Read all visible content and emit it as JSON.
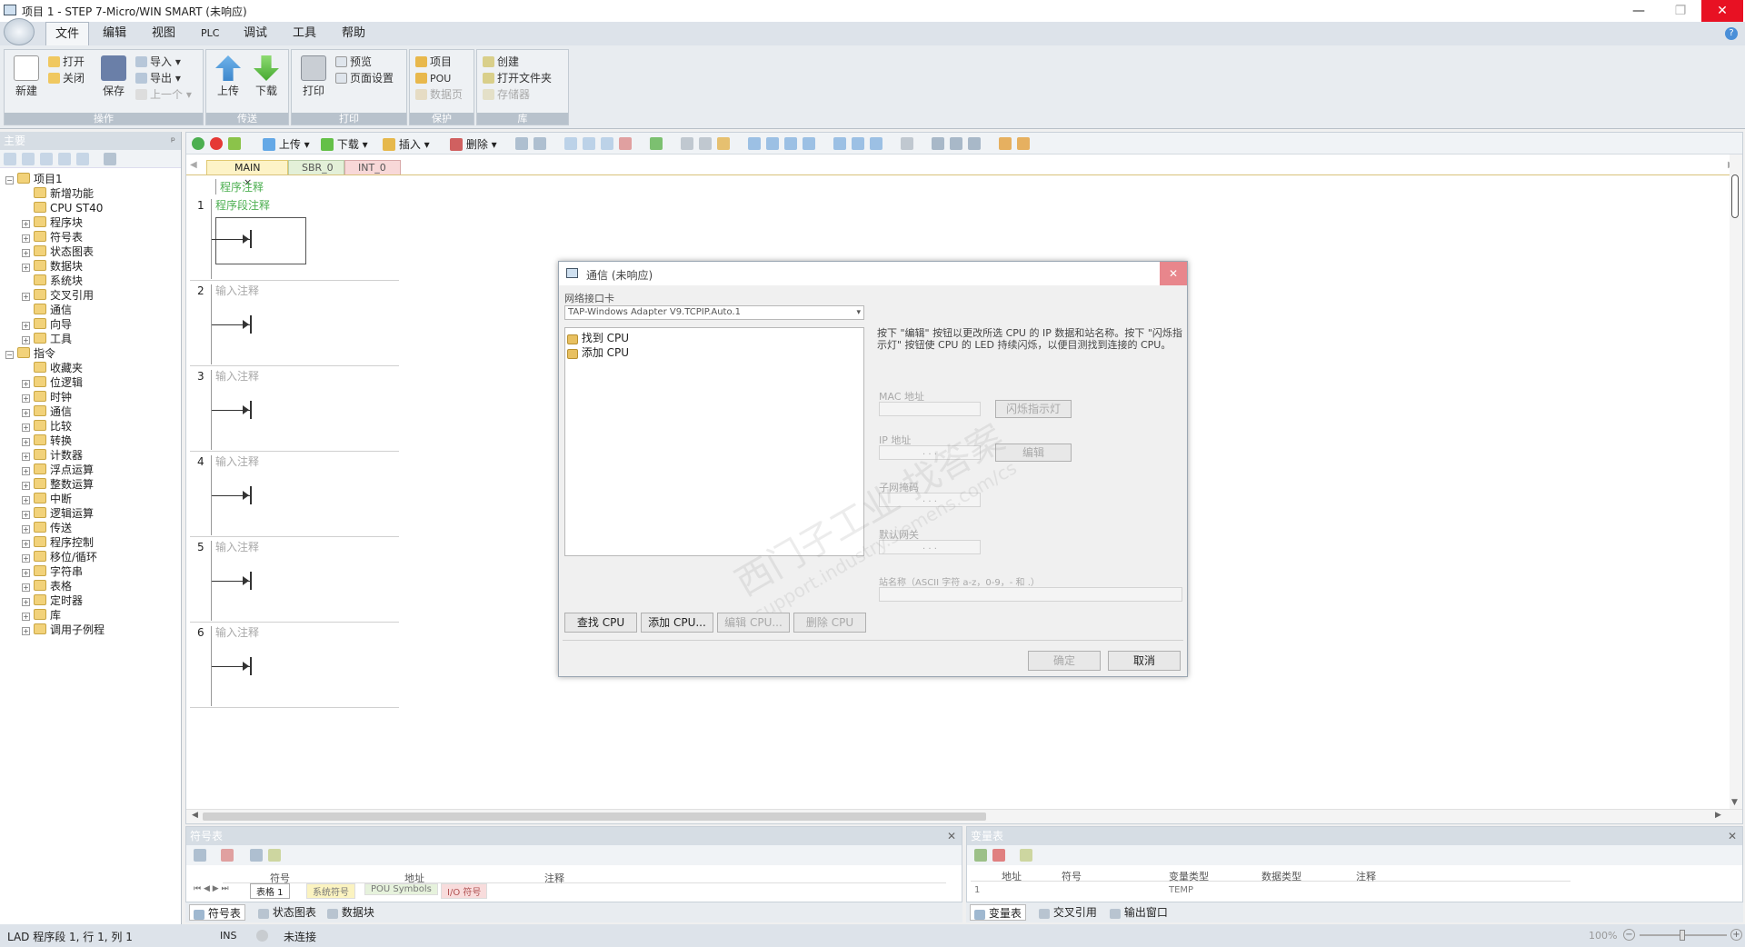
{
  "window": {
    "title": "项目 1 - STEP 7-Micro/WIN SMART (未响应)",
    "minimize_glyph": "—",
    "restore_glyph": "❐",
    "close_glyph": "✕"
  },
  "menu": {
    "items": [
      "文件",
      "编辑",
      "视图",
      "PLC",
      "调试",
      "工具",
      "帮助"
    ],
    "active": "文件",
    "help_glyph": "?"
  },
  "ribbon": {
    "groups": [
      {
        "label": "操作",
        "big": [
          {
            "label": "新建",
            "icon": "new-document-icon"
          },
          {
            "label": "保存",
            "icon": "save-icon"
          }
        ],
        "small": [
          {
            "label": "打开",
            "icon": "open-folder-icon",
            "disabled": false
          },
          {
            "label": "关闭",
            "icon": "close-folder-icon",
            "disabled": false
          },
          {
            "label": "导入",
            "icon": "import-icon",
            "disabled": false
          },
          {
            "label": "导出",
            "icon": "export-icon",
            "disabled": false
          },
          {
            "label": "上一个",
            "icon": "previous-icon",
            "disabled": true
          }
        ]
      },
      {
        "label": "传送",
        "big": [
          {
            "label": "上传",
            "icon": "upload-arrow-icon"
          },
          {
            "label": "下载",
            "icon": "download-arrow-icon"
          }
        ],
        "small": []
      },
      {
        "label": "打印",
        "big": [
          {
            "label": "打印",
            "icon": "printer-icon"
          }
        ],
        "small": [
          {
            "label": "预览",
            "icon": "preview-icon",
            "disabled": false
          },
          {
            "label": "页面设置",
            "icon": "page-setup-icon",
            "disabled": false
          }
        ]
      },
      {
        "label": "保护",
        "big": [],
        "small": [
          {
            "label": "项目",
            "icon": "project-lock-icon",
            "disabled": false
          },
          {
            "label": "POU",
            "icon": "pou-lock-icon",
            "disabled": false
          },
          {
            "label": "数据页",
            "icon": "datapage-lock-icon",
            "disabled": true
          }
        ]
      },
      {
        "label": "库",
        "big": [],
        "small": [
          {
            "label": "创建",
            "icon": "library-create-icon",
            "disabled": false
          },
          {
            "label": "打开文件夹",
            "icon": "library-folder-icon",
            "disabled": false
          },
          {
            "label": "存储器",
            "icon": "memory-icon",
            "disabled": true
          }
        ]
      }
    ]
  },
  "left_panel": {
    "title": "主要",
    "pin_glyph": "ᵖ",
    "tree": [
      {
        "label": "项目1",
        "level": 0,
        "expander": "−",
        "icon": "project-icon"
      },
      {
        "label": "新增功能",
        "level": 1,
        "expander": "",
        "icon": "whats-new-icon"
      },
      {
        "label": "CPU ST40",
        "level": 1,
        "expander": "",
        "icon": "cpu-icon"
      },
      {
        "label": "程序块",
        "level": 1,
        "expander": "+",
        "icon": "program-block-icon"
      },
      {
        "label": "符号表",
        "level": 1,
        "expander": "+",
        "icon": "symbol-table-icon"
      },
      {
        "label": "状态图表",
        "level": 1,
        "expander": "+",
        "icon": "status-chart-icon"
      },
      {
        "label": "数据块",
        "level": 1,
        "expander": "+",
        "icon": "data-block-icon"
      },
      {
        "label": "系统块",
        "level": 1,
        "expander": "",
        "icon": "system-block-icon"
      },
      {
        "label": "交叉引用",
        "level": 1,
        "expander": "+",
        "icon": "cross-reference-icon"
      },
      {
        "label": "通信",
        "level": 1,
        "expander": "",
        "icon": "communication-icon"
      },
      {
        "label": "向导",
        "level": 1,
        "expander": "+",
        "icon": "wizard-icon"
      },
      {
        "label": "工具",
        "level": 1,
        "expander": "+",
        "icon": "tools-icon"
      },
      {
        "label": "指令",
        "level": 0,
        "expander": "−",
        "icon": "instructions-icon"
      },
      {
        "label": "收藏夹",
        "level": 1,
        "expander": "",
        "icon": "favorites-icon"
      },
      {
        "label": "位逻辑",
        "level": 1,
        "expander": "+",
        "icon": "bit-logic-icon"
      },
      {
        "label": "时钟",
        "level": 1,
        "expander": "+",
        "icon": "clock-icon"
      },
      {
        "label": "通信",
        "level": 1,
        "expander": "+",
        "icon": "communication-icon"
      },
      {
        "label": "比较",
        "level": 1,
        "expander": "+",
        "icon": "compare-icon"
      },
      {
        "label": "转换",
        "level": 1,
        "expander": "+",
        "icon": "convert-icon"
      },
      {
        "label": "计数器",
        "level": 1,
        "expander": "+",
        "icon": "counter-icon"
      },
      {
        "label": "浮点运算",
        "level": 1,
        "expander": "+",
        "icon": "floating-point-icon"
      },
      {
        "label": "整数运算",
        "level": 1,
        "expander": "+",
        "icon": "integer-math-icon"
      },
      {
        "label": "中断",
        "level": 1,
        "expander": "+",
        "icon": "interrupt-icon"
      },
      {
        "label": "逻辑运算",
        "level": 1,
        "expander": "+",
        "icon": "logic-ops-icon"
      },
      {
        "label": "传送",
        "level": 1,
        "expander": "+",
        "icon": "move-icon"
      },
      {
        "label": "程序控制",
        "level": 1,
        "expander": "+",
        "icon": "program-control-icon"
      },
      {
        "label": "移位/循环",
        "level": 1,
        "expander": "+",
        "icon": "shift-rotate-icon"
      },
      {
        "label": "字符串",
        "level": 1,
        "expander": "+",
        "icon": "string-icon"
      },
      {
        "label": "表格",
        "level": 1,
        "expander": "+",
        "icon": "table-icon"
      },
      {
        "label": "定时器",
        "level": 1,
        "expander": "+",
        "icon": "timer-icon"
      },
      {
        "label": "库",
        "level": 1,
        "expander": "+",
        "icon": "library-icon"
      },
      {
        "label": "调用子例程",
        "level": 1,
        "expander": "+",
        "icon": "call-subroutine-icon"
      }
    ]
  },
  "editor_toolbar": {
    "upload": "上传",
    "download": "下载",
    "insert": "插入",
    "delete": "删除"
  },
  "editor_tabs": [
    {
      "label": "MAIN",
      "active": true,
      "close": "×"
    },
    {
      "label": "SBR_0",
      "active": false
    },
    {
      "label": "INT_0",
      "active": false
    }
  ],
  "editor": {
    "program_comment": "程序注释",
    "networks": [
      {
        "number": "1",
        "comment": "程序段注释"
      },
      {
        "number": "2",
        "comment": "输入注释"
      },
      {
        "number": "3",
        "comment": "输入注释"
      },
      {
        "number": "4",
        "comment": "输入注释"
      },
      {
        "number": "5",
        "comment": "输入注释"
      },
      {
        "number": "6",
        "comment": "输入注释"
      }
    ],
    "coil_glyph": "→|"
  },
  "dialog": {
    "title": "通信 (未响应)",
    "close_glyph": "✕",
    "nic_label": "网络接口卡",
    "nic_value": "TAP-Windows Adapter V9.TCPIP.Auto.1",
    "list_items": [
      "找到 CPU",
      "添加 CPU"
    ],
    "help_text": "按下 \"编辑\" 按钮以更改所选 CPU 的 IP 数据和站名称。按下 \"闪烁指示灯\" 按钮使 CPU 的 LED 持续闪烁，以便目测找到连接的 CPU。",
    "mac_label": "MAC 地址",
    "blink_button": "闪烁指示灯",
    "ip_label": "IP 地址",
    "edit_button": "编辑",
    "subnet_label": "子网掩码",
    "gateway_label": "默认网关",
    "station_label": "站名称（ASCII 字符 a-z，0-9，- 和 .）",
    "ip_dots": ". . .",
    "buttons": {
      "find": "查找 CPU",
      "add": "添加 CPU...",
      "edit": "编辑 CPU...",
      "delete": "删除 CPU"
    },
    "ok": "确定",
    "cancel": "取消",
    "watermark": "西门子工业 找答案",
    "watermark2": "support.industry.siemens.com/cs"
  },
  "symbol_panel": {
    "title": "符号表",
    "columns": [
      "",
      "",
      "符号",
      "地址",
      "注释"
    ],
    "tabs": [
      "表格 1",
      "系统符号",
      "POU Symbols",
      "I/O 符号"
    ],
    "nav": "⏮ ◀ ▶ ⏭"
  },
  "var_panel": {
    "title": "变量表",
    "columns": [
      "地址",
      "符号",
      "变量类型",
      "数据类型",
      "注释"
    ],
    "rows": [
      [
        "1",
        "",
        "",
        "TEMP",
        "",
        ""
      ]
    ]
  },
  "bottom_tabs_left": [
    "符号表",
    "状态图表",
    "数据块"
  ],
  "bottom_tabs_right": [
    "变量表",
    "交叉引用",
    "输出窗口"
  ],
  "status": {
    "position": "LAD 程序段 1, 行 1, 列 1",
    "mode": "INS",
    "connection": "未连接",
    "zoom": "100%"
  }
}
